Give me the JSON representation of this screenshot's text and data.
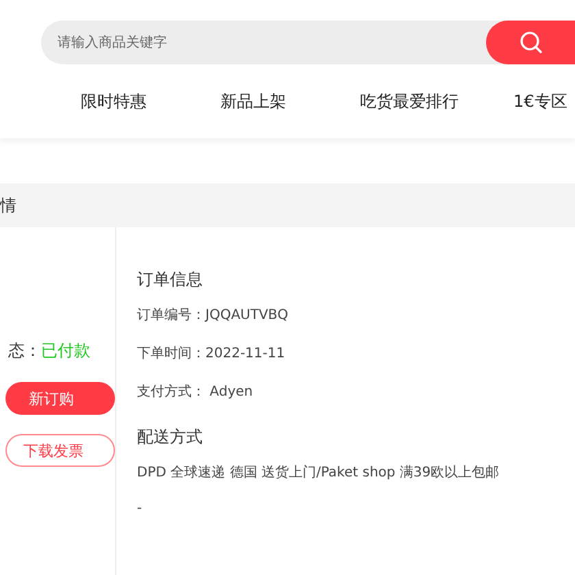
{
  "search": {
    "placeholder": "请输入商品关键字"
  },
  "nav": [
    {
      "label": "限时特惠"
    },
    {
      "label": "新品上架"
    },
    {
      "label": "吃货最爱排行"
    },
    {
      "label": "1€专区"
    }
  ],
  "section_header": "情",
  "status": {
    "label": "态：",
    "value": "已付款"
  },
  "actions": [
    {
      "label": "新订购",
      "kind": "primary"
    },
    {
      "label": "下载发票",
      "kind": "outline"
    }
  ],
  "order_info": {
    "title": "订单信息",
    "lines": [
      "订单编号：JQQAUTVBQ",
      "下单时间：2022-11-11",
      "支付方式： Adyen"
    ]
  },
  "shipping": {
    "title": "配送方式",
    "lines": [
      "DPD 全球速递 德国 送货上门/Paket shop 满39欧以上包邮",
      "-"
    ]
  }
}
